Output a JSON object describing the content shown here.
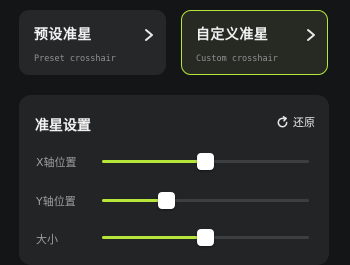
{
  "modes": [
    {
      "title": "预设准星",
      "subtitle": "Preset crosshair",
      "selected": false
    },
    {
      "title": "自定义准星",
      "subtitle": "Custom crosshair",
      "selected": true
    }
  ],
  "settings": {
    "title": "准星设置",
    "reset_label": "还原",
    "sliders": [
      {
        "label": "X轴位置",
        "value_fraction": 0.5
      },
      {
        "label": "Y轴位置",
        "value_fraction": 0.31
      },
      {
        "label": "大小",
        "value_fraction": 0.5
      }
    ]
  },
  "colors": {
    "accent": "#b6e63a",
    "card_bg": "#252729",
    "panel_bg": "#222426",
    "page_bg": "#141516"
  },
  "icons": {
    "chevron": "chevron-right-icon",
    "reset": "reset-icon"
  }
}
